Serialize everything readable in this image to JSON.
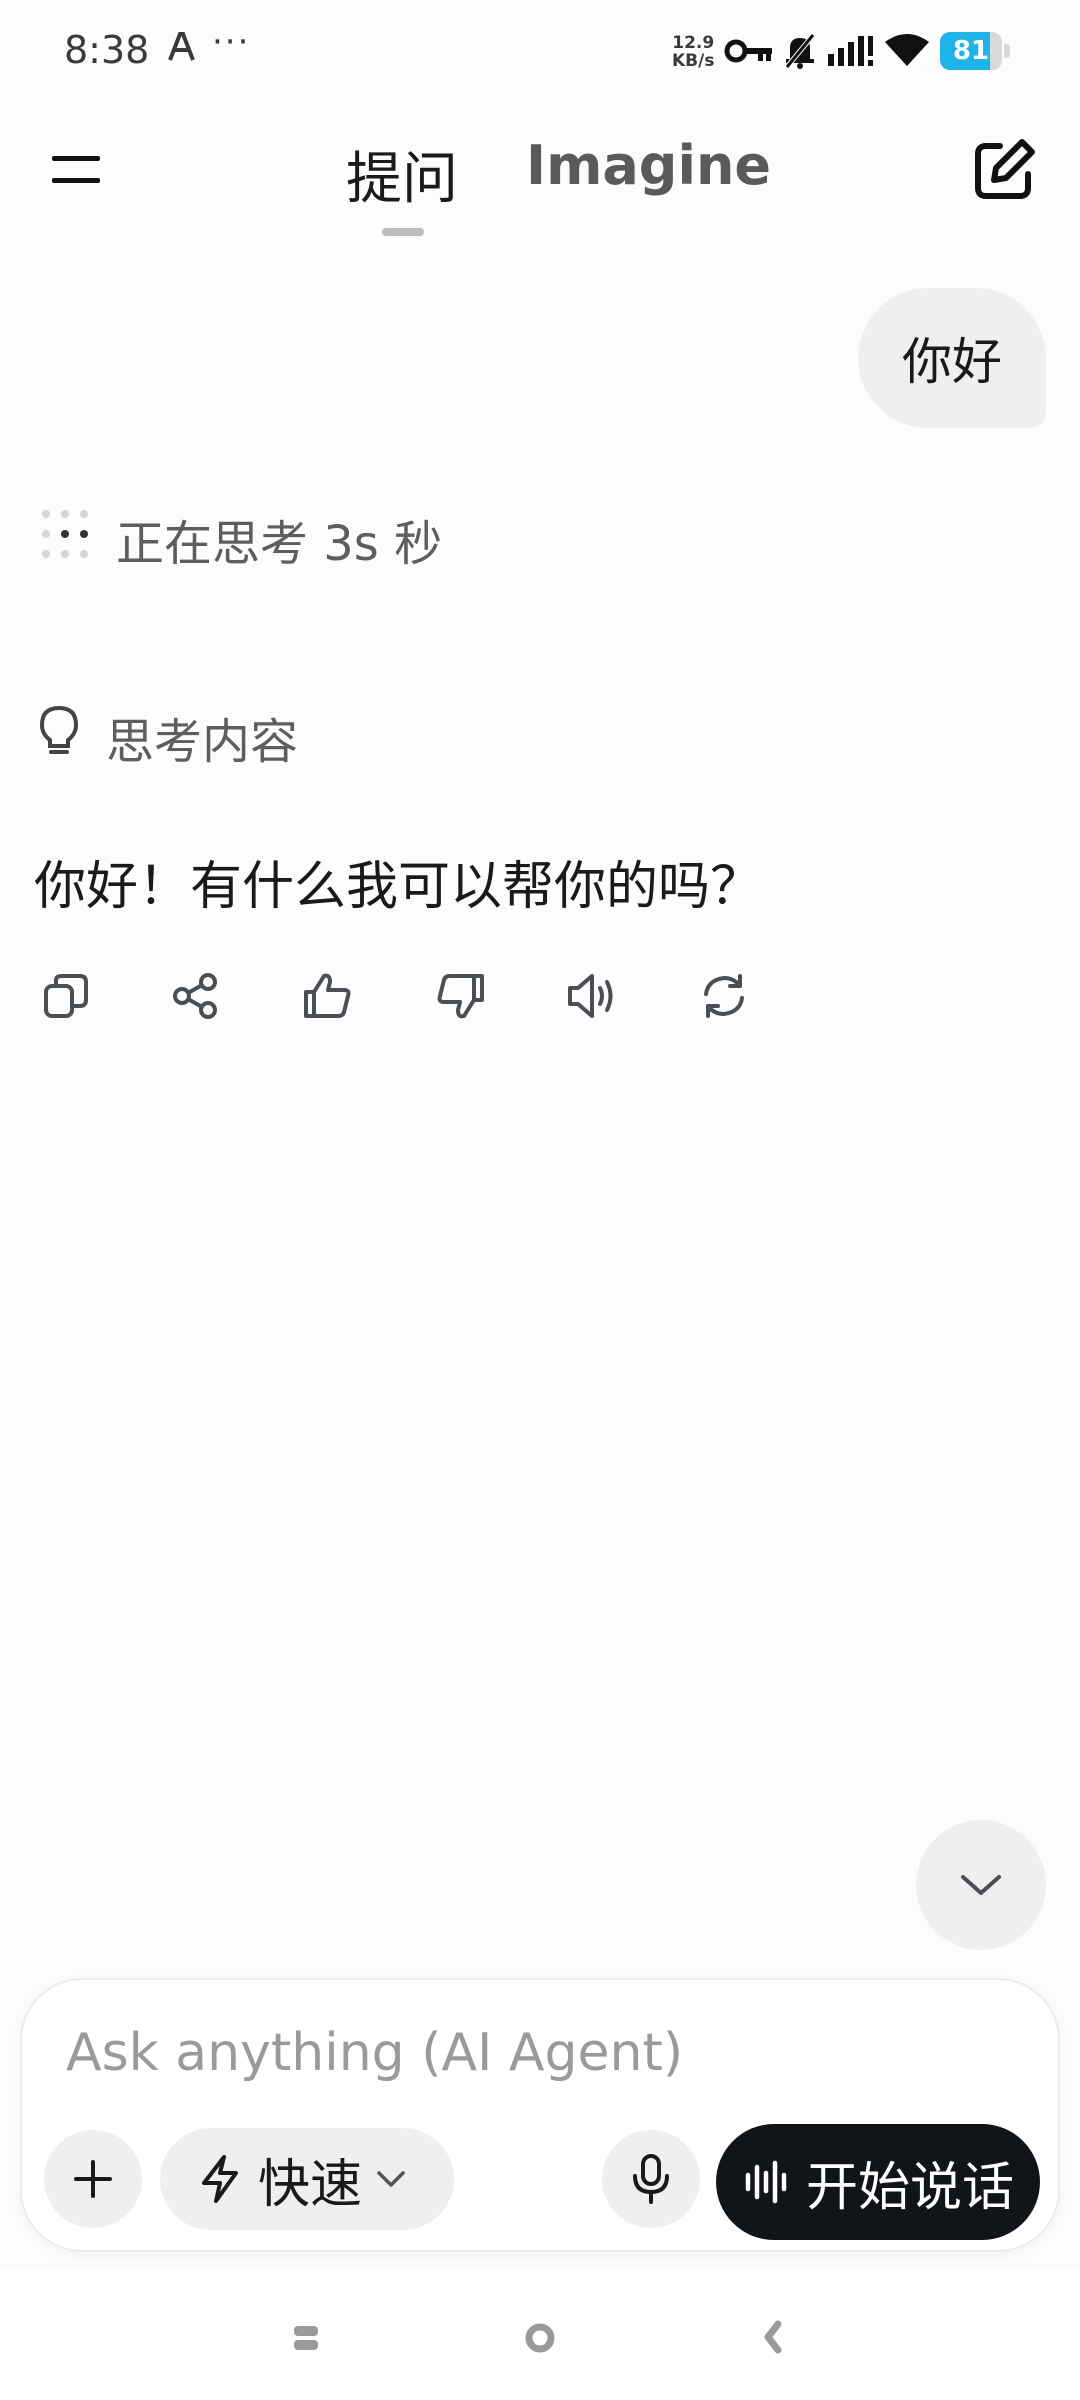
{
  "status_bar": {
    "time": "8:38",
    "more": "···",
    "net_speed_value": "12.9",
    "net_speed_unit": "KB/s",
    "battery_percent": "81",
    "battery_level": 0.81,
    "battery_color": "#1fb4e8"
  },
  "header": {
    "tabs": [
      {
        "label": "提问",
        "active": true
      },
      {
        "label": "Imagine",
        "active": false
      }
    ],
    "menu_icon": "hamburger-icon",
    "new_chat_icon": "edit-icon"
  },
  "chat": {
    "user_message": "你好",
    "thinking_status": "正在思考 3s 秒",
    "thought_label": "思考内容",
    "answer": "你好！有什么我可以帮你的吗？",
    "actions": [
      "copy-icon",
      "share-icon",
      "thumbs-up-icon",
      "thumbs-down-icon",
      "speaker-icon",
      "regenerate-icon"
    ]
  },
  "composer": {
    "placeholder": "Ask anything (AI Agent)",
    "value": "",
    "mode_label": "快速",
    "talk_label": "开始说话"
  },
  "colors": {
    "background": "#fcfcfc",
    "bubble": "#efefee",
    "talk_button": "#111418"
  }
}
